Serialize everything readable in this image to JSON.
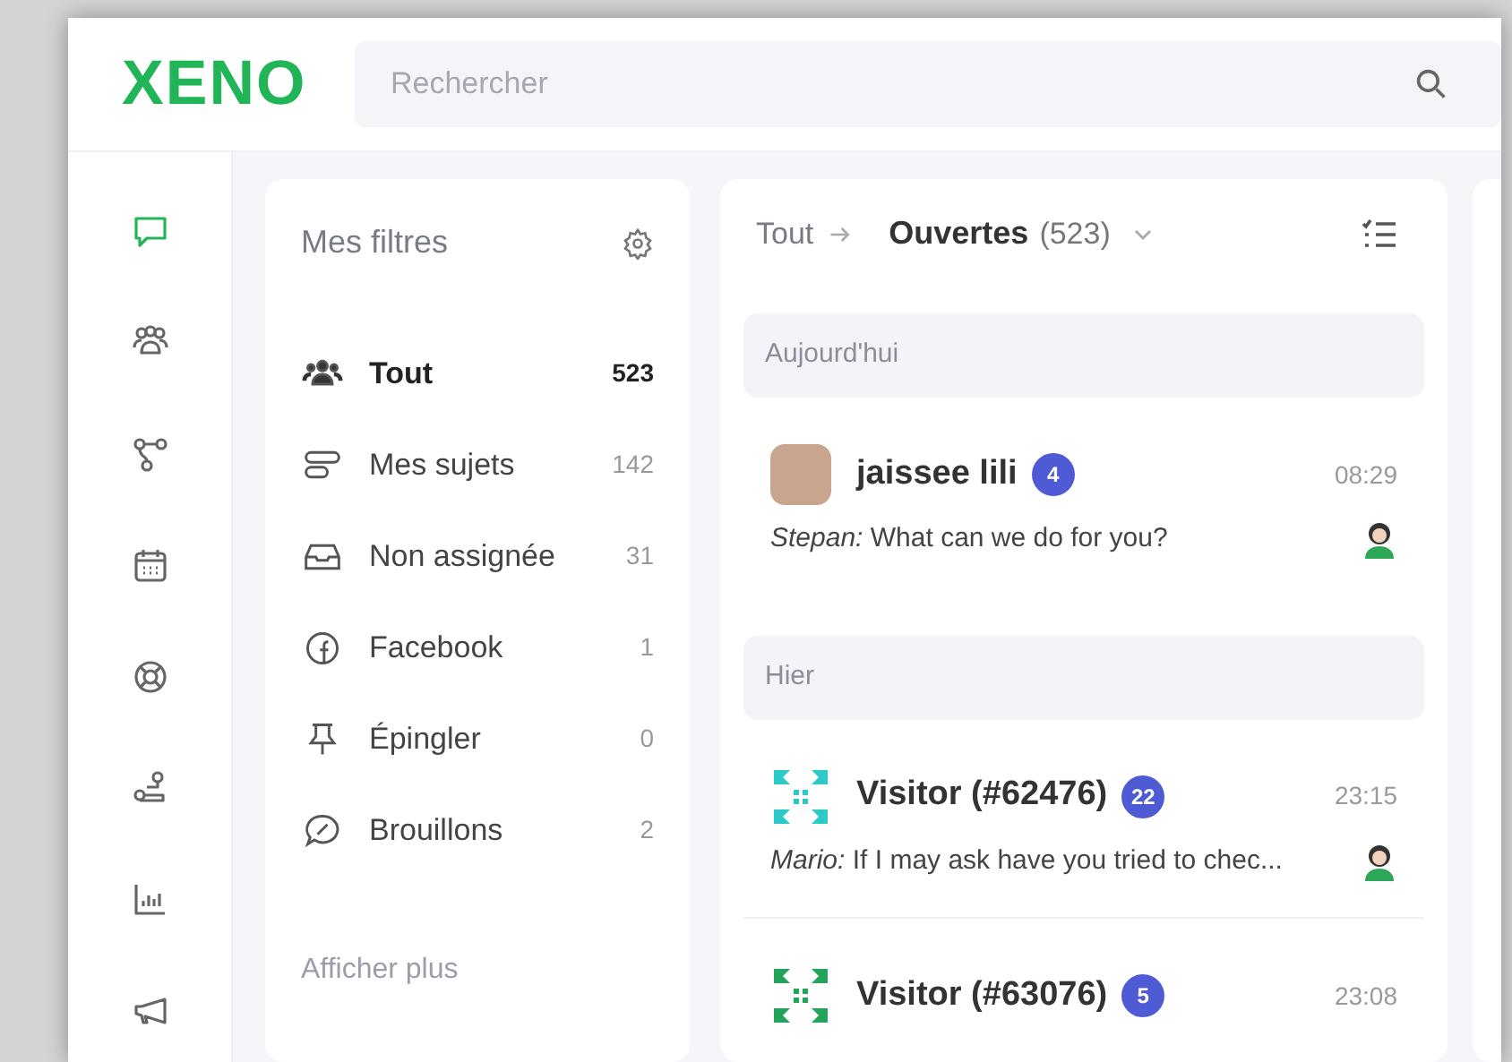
{
  "header": {
    "logo": "XENO",
    "search": {
      "placeholder": "Rechercher"
    }
  },
  "rail": [
    {
      "selected": true
    },
    {
      "selected": false
    },
    {
      "selected": false
    },
    {
      "selected": false
    },
    {
      "selected": false
    },
    {
      "selected": false
    },
    {
      "selected": false
    },
    {
      "selected": false
    }
  ],
  "filters": {
    "title": "Mes filtres",
    "items": [
      {
        "label": "Tout",
        "count": "523",
        "selected": true
      },
      {
        "label": "Mes sujets",
        "count": "142",
        "selected": false
      },
      {
        "label": "Non assignée",
        "count": "31",
        "selected": false
      },
      {
        "label": "Facebook",
        "count": "1",
        "selected": false
      },
      {
        "label": "Épingler",
        "count": "0",
        "selected": false
      },
      {
        "label": "Brouillons",
        "count": "2",
        "selected": false
      }
    ],
    "more": "Afficher plus"
  },
  "conversations": {
    "breadcrumb": "Tout",
    "view": "Ouvertes",
    "view_count": "(523)",
    "groups": [
      {
        "label": "Aujourd'hui",
        "items": [
          {
            "kind": "photo",
            "name": "jaissee lili",
            "unread": "4",
            "time": "08:29",
            "preview": "*Stepan:* What can we do for you?"
          }
        ]
      },
      {
        "label": "Hier",
        "items": [
          {
            "kind": "pattern",
            "color": "#2cc9c9",
            "name": "Visitor (#62476)",
            "unread": "22",
            "time": "23:15",
            "preview": "*Mario:* If I may ask have you tried to chec..."
          },
          {
            "kind": "pattern",
            "color": "#22a559",
            "name": "Visitor (#63076)",
            "unread": "5",
            "time": "23:08"
          }
        ]
      }
    ]
  }
}
